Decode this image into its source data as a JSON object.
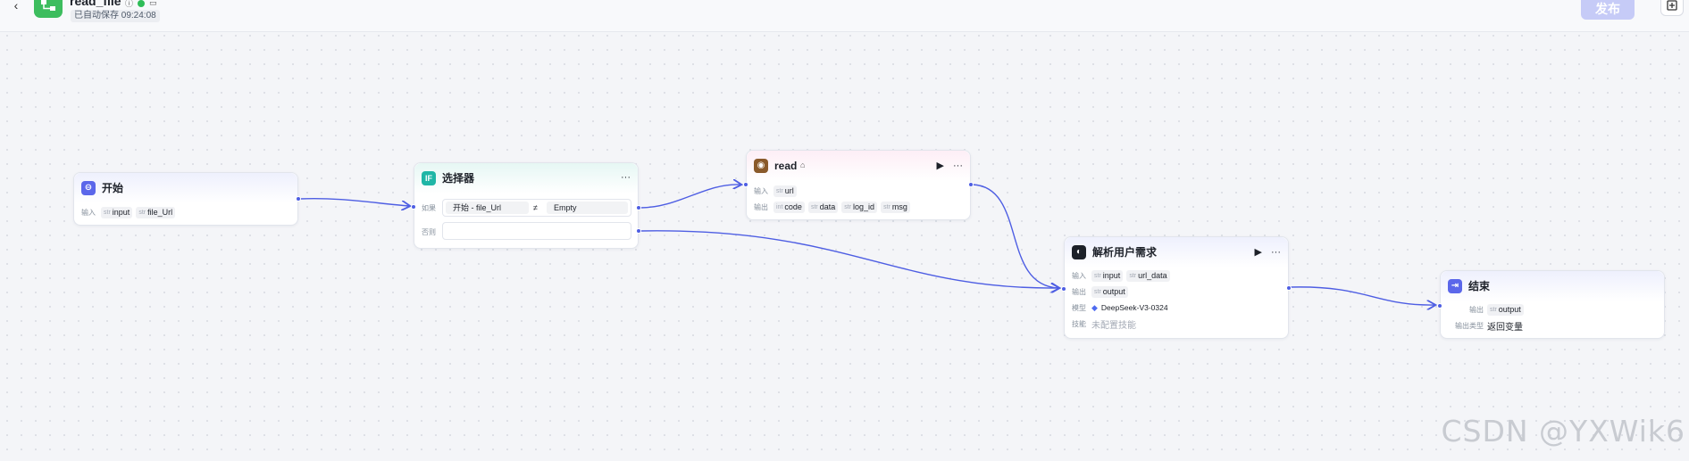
{
  "header": {
    "app_name": "read_file",
    "autosave": "已自动保存 09:24:08",
    "publish_label": "发布",
    "accent": "#3dbd5e"
  },
  "nodes": {
    "start": {
      "title": "开始",
      "input_label": "输入",
      "params": [
        {
          "type": "str",
          "name": "input"
        },
        {
          "type": "str",
          "name": "file_Url"
        }
      ]
    },
    "selector": {
      "title": "选择器",
      "icon_text": "IF",
      "if_label": "如果",
      "else_label": "否则",
      "condition_source": "开始",
      "condition_field": "file_Url",
      "operator": "≠",
      "condition_value": "Empty"
    },
    "read": {
      "title": "read",
      "input_label": "输入",
      "output_label": "输出",
      "inputs": [
        {
          "type": "str",
          "name": "url"
        }
      ],
      "outputs": [
        {
          "type": "int",
          "name": "code"
        },
        {
          "type": "str",
          "name": "data"
        },
        {
          "type": "str",
          "name": "log_id"
        },
        {
          "type": "str",
          "name": "msg"
        }
      ]
    },
    "llm": {
      "title": "解析用户需求",
      "input_label": "输入",
      "output_label": "输出",
      "model_label": "模型",
      "skill_label": "技能",
      "inputs": [
        {
          "type": "str",
          "name": "input"
        },
        {
          "type": "str",
          "name": "url_data"
        }
      ],
      "outputs": [
        {
          "type": "str",
          "name": "output"
        }
      ],
      "model": "DeepSeek-V3-0324",
      "skills": "未配置技能"
    },
    "end": {
      "title": "结束",
      "output_label": "输出",
      "output_type_label": "输出类型",
      "outputs": [
        {
          "type": "str",
          "name": "output"
        }
      ],
      "output_type": "返回变量"
    }
  },
  "watermark": "CSDN @YXWik6"
}
